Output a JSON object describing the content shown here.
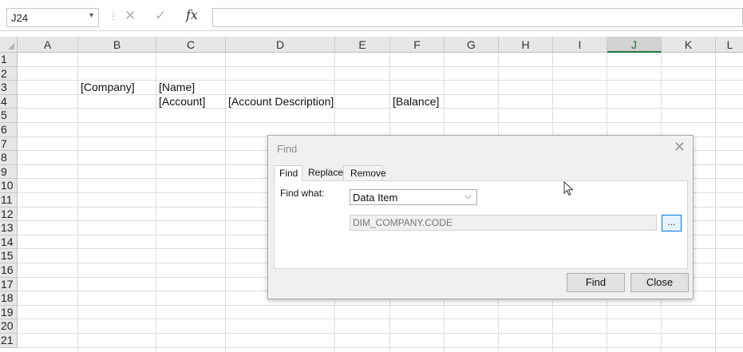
{
  "formula_bar": {
    "name_box": "J24",
    "cancel_icon": "✕",
    "enter_icon": "✓",
    "fx_label": "fx",
    "formula": ""
  },
  "columns": [
    "A",
    "B",
    "C",
    "D",
    "E",
    "F",
    "G",
    "H",
    "I",
    "J",
    "K",
    "L"
  ],
  "selected_column": "J",
  "rows": [
    "1",
    "2",
    "3",
    "4",
    "5",
    "6",
    "7",
    "8",
    "9",
    "10",
    "11",
    "12",
    "13",
    "14",
    "15",
    "16",
    "17",
    "18",
    "19",
    "20",
    "21"
  ],
  "cells": {
    "B3": "[Company]",
    "C3": "[Name]",
    "C4": "[Account]",
    "D4": "[Account Description]",
    "F4": "[Balance]"
  },
  "find_dialog": {
    "title": "Find",
    "tabs": [
      "Find",
      "Replace",
      "Remove"
    ],
    "active_tab": "Find",
    "find_what_label": "Find what:",
    "find_what_selected": "Data Item",
    "data_item_value": "DIM_COMPANY.CODE",
    "browse_label": "...",
    "find_button": "Find",
    "close_button": "Close"
  }
}
